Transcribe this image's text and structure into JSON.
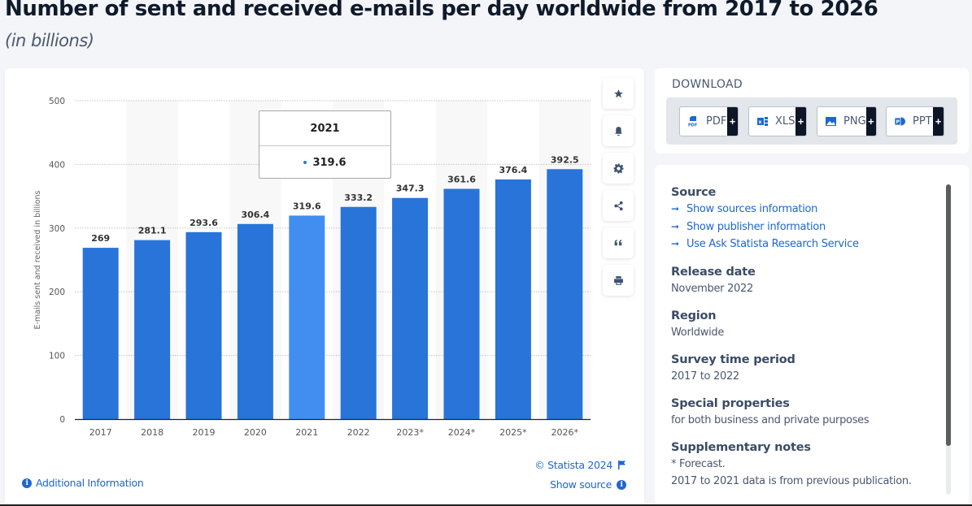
{
  "header": {
    "title": "Number of sent and received e-mails per day worldwide from 2017 to 2026",
    "subtitle": "(in billions)"
  },
  "colors": {
    "bar": "#2874d9",
    "bar_highlight": "#418ef0",
    "link": "#1d67d0",
    "axis_text": "#555555"
  },
  "chart_data": {
    "type": "bar",
    "title": "Number of sent and received e-mails per day worldwide from 2017 to 2026",
    "subtitle": "(in billions)",
    "categories": [
      "2017",
      "2018",
      "2019",
      "2020",
      "2021",
      "2022",
      "2023*",
      "2024*",
      "2025*",
      "2026*"
    ],
    "values": [
      269,
      281.1,
      293.6,
      306.4,
      319.6,
      333.2,
      347.3,
      361.6,
      376.4,
      392.5
    ],
    "value_labels": [
      "269",
      "281.1",
      "293.6",
      "306.4",
      "319.6",
      "333.2",
      "347.3",
      "361.6",
      "376.4",
      "392.5"
    ],
    "xlabel": "",
    "ylabel": "E-mails sent and received in billions",
    "ylim": [
      0,
      500
    ],
    "yticks": [
      0,
      100,
      200,
      300,
      400,
      500
    ],
    "ytick_labels": [
      "0",
      "100",
      "200",
      "300",
      "400",
      "500"
    ],
    "grid": true,
    "highlighted_category": "2021",
    "legend": "none"
  },
  "tooltip": {
    "title": "2021",
    "value": "319.6"
  },
  "toolbar": {
    "buttons": [
      {
        "name": "favorite",
        "icon": "star-icon"
      },
      {
        "name": "notification",
        "icon": "bell-icon"
      },
      {
        "name": "settings",
        "icon": "gear-icon"
      },
      {
        "name": "share",
        "icon": "share-icon"
      },
      {
        "name": "cite",
        "icon": "quote-icon"
      },
      {
        "name": "print",
        "icon": "printer-icon"
      }
    ]
  },
  "chart_footer": {
    "additional_info": "Additional Information",
    "copyright": "© Statista 2024",
    "show_source": "Show source"
  },
  "download": {
    "title": "DOWNLOAD",
    "buttons": [
      {
        "label": "PDF",
        "icon": "pdf-icon",
        "plus": "+"
      },
      {
        "label": "XLS",
        "icon": "xls-icon",
        "plus": "+"
      },
      {
        "label": "PNG",
        "icon": "png-icon",
        "plus": "+"
      },
      {
        "label": "PPT",
        "icon": "ppt-icon",
        "plus": "+"
      }
    ]
  },
  "info": {
    "source": {
      "heading": "Source",
      "links": [
        "Show sources information",
        "Show publisher information",
        "Use Ask Statista Research Service"
      ]
    },
    "release_date": {
      "heading": "Release date",
      "value": "November 2022"
    },
    "region": {
      "heading": "Region",
      "value": "Worldwide"
    },
    "survey_period": {
      "heading": "Survey time period",
      "value": "2017 to 2022"
    },
    "special_properties": {
      "heading": "Special properties",
      "value": "for both business and private purposes"
    },
    "supplementary_notes": {
      "heading": "Supplementary notes",
      "lines": [
        "* Forecast.",
        "2017 to 2021 data is from previous publication."
      ]
    }
  }
}
